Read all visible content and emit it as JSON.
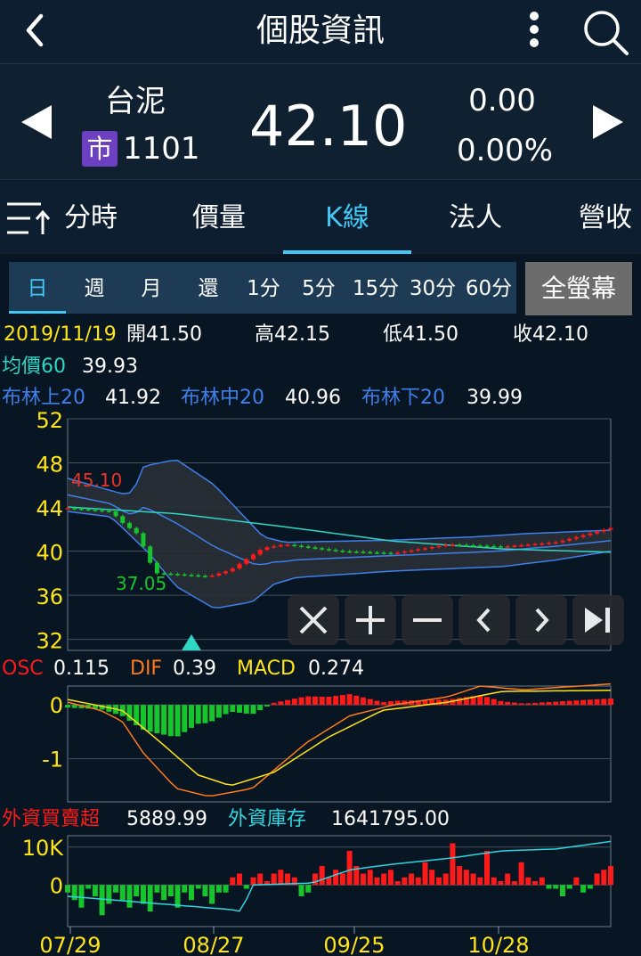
{
  "header": {
    "title": "個股資訊",
    "back_icon": "chevron-left-icon",
    "menu_icon": "more-vertical-icon",
    "search_icon": "search-icon"
  },
  "quote": {
    "name": "台泥",
    "market_badge": "市",
    "code": "1101",
    "price": "42.10",
    "change": "0.00",
    "change_pct": "0.00%"
  },
  "tabs": [
    {
      "label": "分時",
      "active": false
    },
    {
      "label": "價量",
      "active": false
    },
    {
      "label": "K線",
      "active": true
    },
    {
      "label": "法人",
      "active": false
    },
    {
      "label": "營收",
      "active": false
    }
  ],
  "periods": [
    "日",
    "週",
    "月",
    "還",
    "1分",
    "5分",
    "15分",
    "30分",
    "60分"
  ],
  "fullscreen_label": "全螢幕",
  "ohlc": {
    "date": "2019/11/19",
    "open": "開41.50",
    "high": "高42.15",
    "low": "低41.50",
    "close": "收42.10"
  },
  "ma": {
    "label": "均價60",
    "value": "39.93"
  },
  "bollinger": {
    "upper_label": "布林上20",
    "upper_value": "41.92",
    "mid_label": "布林中20",
    "mid_value": "40.96",
    "lower_label": "布林下20",
    "lower_value": "39.99"
  },
  "macd": {
    "osc_label": "OSC",
    "osc_value": "0.115",
    "dif_label": "DIF",
    "dif_value": "0.39",
    "macd_label": "MACD",
    "macd_value": "0.274"
  },
  "foreign": {
    "net_label": "外資買賣超",
    "net_value": "5889.99",
    "holding_label": "外資庫存",
    "holding_value": "1641795.00"
  },
  "colors": {
    "up": "#ff1a1a",
    "down": "#16c52c",
    "accent": "#43c8f4",
    "ma60": "#2fd6c4",
    "bollinger": "#3f7fea",
    "dif": "#ff7a1c",
    "macd": "#ffe418",
    "axis_label": "#ffe418",
    "panel_bg": "#081522"
  },
  "chart_data": [
    {
      "type": "line",
      "name": "price",
      "ylim": [
        31,
        52
      ],
      "yticks": [
        "32",
        "36",
        "40",
        "44",
        "48",
        "52"
      ],
      "annotations": {
        "max_price": "45.10",
        "min_price": "37.05"
      },
      "controls": [
        "close-icon",
        "zoom-in-icon",
        "zoom-out-icon",
        "prev-icon",
        "next-icon",
        "skip-end-icon"
      ],
      "marker": "triangle-up"
    },
    {
      "type": "bar",
      "name": "macd",
      "ylim": [
        -1.8,
        0.35
      ],
      "yticks": [
        "0",
        "-1"
      ]
    },
    {
      "type": "bar",
      "name": "foreign",
      "ylim": [
        -11000,
        13000
      ],
      "yticks": [
        "10K",
        "0"
      ],
      "xticks": [
        "07/29",
        "08/27",
        "09/25",
        "10/28"
      ]
    }
  ]
}
